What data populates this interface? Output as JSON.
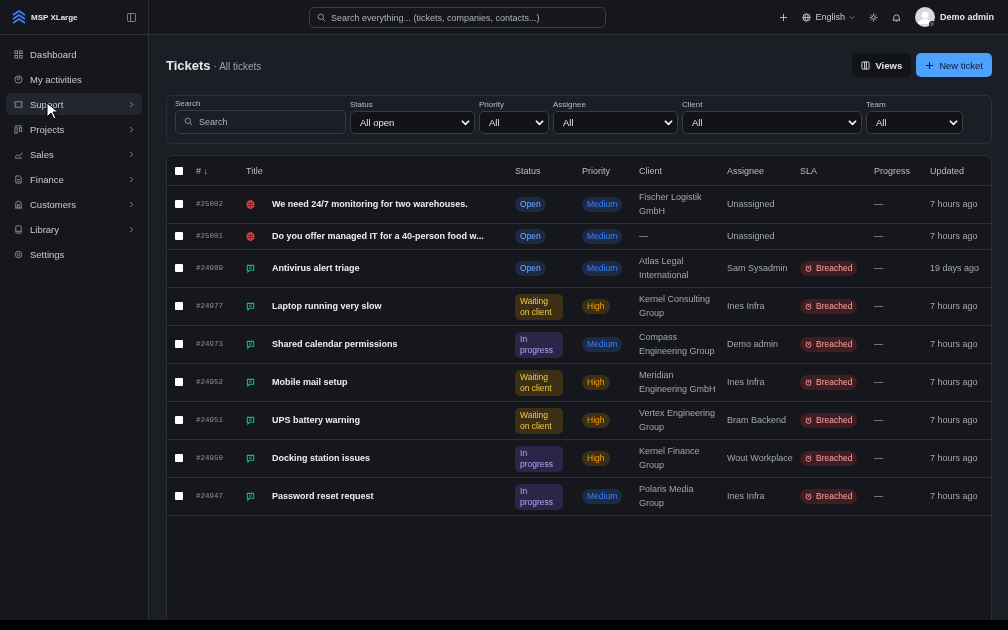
{
  "brand": {
    "name": "MSP XLarge"
  },
  "sidebar": {
    "items": [
      {
        "label": "Dashboard",
        "expandable": false,
        "highlighted": false
      },
      {
        "label": "My activities",
        "expandable": false,
        "highlighted": false
      },
      {
        "label": "Support",
        "expandable": true,
        "highlighted": true
      },
      {
        "label": "Projects",
        "expandable": true,
        "highlighted": false
      },
      {
        "label": "Sales",
        "expandable": true,
        "highlighted": false
      },
      {
        "label": "Finance",
        "expandable": true,
        "highlighted": false
      },
      {
        "label": "Customers",
        "expandable": true,
        "highlighted": false
      },
      {
        "label": "Library",
        "expandable": true,
        "highlighted": false
      },
      {
        "label": "Settings",
        "expandable": false,
        "highlighted": false
      }
    ]
  },
  "topbar": {
    "search_placeholder": "Search everything... (tickets, companies, contacts...)",
    "language": "English",
    "user": "Demo admin"
  },
  "page": {
    "title": "Tickets",
    "subtitle": "· All tickets",
    "buttons": [
      {
        "label": "Views",
        "kind": "secondary"
      },
      {
        "label": "New ticket",
        "kind": "primary"
      }
    ]
  },
  "filters": {
    "search": {
      "label": "Search",
      "placeholder": "Search"
    },
    "selects": [
      {
        "label": "Status",
        "value": "All open"
      },
      {
        "label": "Priority",
        "value": "All"
      },
      {
        "label": "Assignee",
        "value": "All"
      },
      {
        "label": "Client",
        "value": "All"
      },
      {
        "label": "Team",
        "value": "All"
      }
    ]
  },
  "table": {
    "select_all_checked": false,
    "columns": [
      "# ↓",
      "Title",
      "Status",
      "Priority",
      "Client",
      "Assignee",
      "SLA",
      "Progress",
      "Updated"
    ],
    "rows": [
      {
        "id": "#25002",
        "kind": "web",
        "title": "We need 24/7 monitoring for two warehouses.",
        "status": {
          "label": "Open",
          "kind": "open"
        },
        "priority": {
          "label": "Medium",
          "kind": "medium"
        },
        "client": "Fischer Logistik GmbH",
        "assignee": "Unassigned",
        "sla": null,
        "progress": "—",
        "updated": "7 hours ago",
        "checked": false
      },
      {
        "id": "#25001",
        "kind": "web",
        "title": "Do you offer managed IT for a 40-person food w...",
        "status": {
          "label": "Open",
          "kind": "open"
        },
        "priority": {
          "label": "Medium",
          "kind": "medium"
        },
        "client": "—",
        "assignee": "Unassigned",
        "sla": null,
        "progress": "—",
        "updated": "7 hours ago",
        "checked": false
      },
      {
        "id": "#24989",
        "kind": "chat",
        "title": "Antivirus alert triage",
        "status": {
          "label": "Open",
          "kind": "open"
        },
        "priority": {
          "label": "Medium",
          "kind": "medium"
        },
        "client": "Atlas Legal International",
        "assignee": "Sam Sysadmin",
        "sla": "Breached",
        "progress": "—",
        "updated": "19 days ago",
        "checked": false
      },
      {
        "id": "#24977",
        "kind": "chat",
        "title": "Laptop running very slow",
        "status": {
          "label": "Waiting on client",
          "kind": "waiting"
        },
        "priority": {
          "label": "High",
          "kind": "high"
        },
        "client": "Kernel Consulting Group",
        "assignee": "Ines Infra",
        "sla": "Breached",
        "progress": "—",
        "updated": "7 hours ago",
        "checked": false
      },
      {
        "id": "#24973",
        "kind": "chat",
        "title": "Shared calendar permissions",
        "status": {
          "label": "In progress",
          "kind": "progress"
        },
        "priority": {
          "label": "Medium",
          "kind": "medium"
        },
        "client": "Compass Engineering Group",
        "assignee": "Demo admin",
        "sla": "Breached",
        "progress": "—",
        "updated": "7 hours ago",
        "checked": false
      },
      {
        "id": "#24952",
        "kind": "chat",
        "title": "Mobile mail setup",
        "status": {
          "label": "Waiting on client",
          "kind": "waiting"
        },
        "priority": {
          "label": "High",
          "kind": "high"
        },
        "client": "Meridian Engineering GmbH",
        "assignee": "Ines Infra",
        "sla": "Breached",
        "progress": "—",
        "updated": "7 hours ago",
        "checked": false
      },
      {
        "id": "#24951",
        "kind": "chat",
        "title": "UPS battery warning",
        "status": {
          "label": "Waiting on client",
          "kind": "waiting"
        },
        "priority": {
          "label": "High",
          "kind": "high"
        },
        "client": "Vertex Engineering Group",
        "assignee": "Bram Backend",
        "sla": "Breached",
        "progress": "—",
        "updated": "7 hours ago",
        "checked": false
      },
      {
        "id": "#24950",
        "kind": "chat",
        "title": "Docking station issues",
        "status": {
          "label": "In progress",
          "kind": "progress"
        },
        "priority": {
          "label": "High",
          "kind": "high"
        },
        "client": "Kernel Finance Group",
        "assignee": "Wout Workplace",
        "sla": "Breached",
        "progress": "—",
        "updated": "7 hours ago",
        "checked": false
      },
      {
        "id": "#24947",
        "kind": "chat",
        "title": "Password reset request",
        "status": {
          "label": "In progress",
          "kind": "progress"
        },
        "priority": {
          "label": "Medium",
          "kind": "medium"
        },
        "client": "Polaris Media Group",
        "assignee": "Ines Infra",
        "sla": "Breached",
        "progress": "—",
        "updated": "7 hours ago",
        "checked": false
      }
    ]
  }
}
